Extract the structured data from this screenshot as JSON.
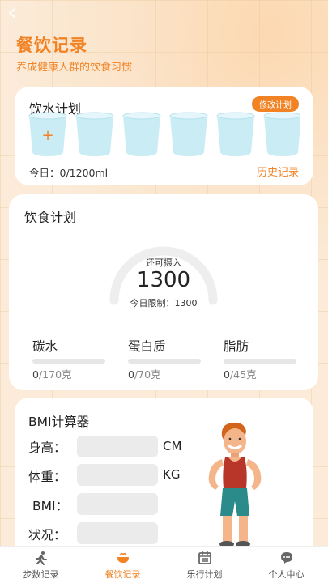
{
  "header": {
    "title": "餐饮记录",
    "subtitle": "养成健康人群的饮食习惯"
  },
  "water": {
    "title": "饮水计划",
    "edit_label": "修改计划",
    "add_symbol": "+",
    "cup_count": 6,
    "today_text": "今日：0/1200ml",
    "history_label": "历史记录"
  },
  "diet": {
    "title": "饮食计划",
    "gauge_label": "还可摄入",
    "gauge_value": "1300",
    "limit_text": "今日限制：1300",
    "nutrients": [
      {
        "name": "碳水",
        "current": "0",
        "total": "/170克",
        "progress": 0
      },
      {
        "name": "蛋白质",
        "current": "0",
        "total": "/70克",
        "progress": 0
      },
      {
        "name": "脂肪",
        "current": "0",
        "total": "/45克",
        "progress": 0
      }
    ]
  },
  "bmi": {
    "title": "BMI计算器",
    "fields": [
      {
        "label": "身高：",
        "unit": "CM",
        "value": ""
      },
      {
        "label": "体重：",
        "unit": "KG",
        "value": ""
      },
      {
        "label": "BMI：",
        "unit": "",
        "value": ""
      },
      {
        "label": "状况：",
        "unit": "",
        "value": ""
      }
    ]
  },
  "tabs": [
    {
      "label": "步数记录",
      "icon": "running-icon",
      "active": false
    },
    {
      "label": "餐饮记录",
      "icon": "food-bowl-icon",
      "active": true
    },
    {
      "label": "乐行计划",
      "icon": "calendar-icon",
      "active": false
    },
    {
      "label": "个人中心",
      "icon": "chat-bubble-icon",
      "active": false
    }
  ],
  "colors": {
    "accent": "#f28325",
    "cup": "#c9ecf5",
    "input": "#ebebeb"
  }
}
